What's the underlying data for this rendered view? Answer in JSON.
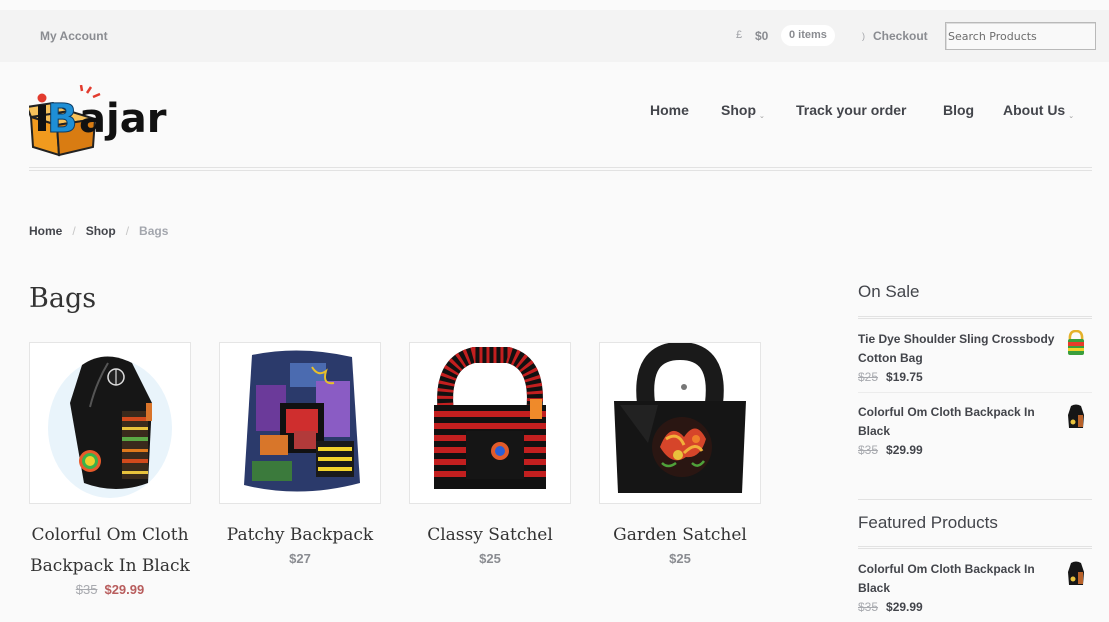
{
  "topbar": {
    "account": "My Account",
    "cart_icon": "£",
    "cart_amount": "$0",
    "cart_count": "0 items",
    "checkout_icon": ")",
    "checkout": "Checkout",
    "search_placeholder": "Search Products"
  },
  "logo": {
    "icon": "ibajar-box-logo"
  },
  "nav": {
    "items": [
      {
        "label": "Home"
      },
      {
        "label": "Shop",
        "has_submenu": true
      },
      {
        "label": "Track your order"
      },
      {
        "label": "Blog"
      },
      {
        "label": "About Us",
        "has_submenu": true
      }
    ],
    "caret": "⌄"
  },
  "breadcrumb": {
    "items": [
      "Home",
      "Shop"
    ],
    "current": "Bags",
    "separator": "/"
  },
  "page_title": "Bags",
  "products": [
    {
      "name": "Colorful Om Cloth Backpack In Black",
      "price_old": "$35",
      "price": "$29.99",
      "image_icon": "black-peace-backpack-icon"
    },
    {
      "name": "Patchy Backpack",
      "price": "$27",
      "image_icon": "patchwork-backpack-icon"
    },
    {
      "name": "Classy Satchel",
      "price": "$25",
      "image_icon": "red-black-striped-satchel-icon"
    },
    {
      "name": "Garden Satchel",
      "price": "$25",
      "image_icon": "embroidered-black-satchel-icon"
    }
  ],
  "sidebar": {
    "on_sale": {
      "title": "On Sale",
      "items": [
        {
          "name": "Tie Dye Shoulder Sling Crossbody Cotton Bag",
          "price_old": "$25",
          "price": "$19.75",
          "thumb_icon": "tie-dye-bag-icon"
        },
        {
          "name": "Colorful Om Cloth Backpack In Black",
          "price_old": "$35",
          "price": "$29.99",
          "thumb_icon": "black-backpack-icon"
        }
      ]
    },
    "featured": {
      "title": "Featured Products",
      "items": [
        {
          "name": "Colorful Om Cloth Backpack In Black",
          "price_old": "$35",
          "price": "$29.99",
          "thumb_icon": "black-backpack-icon"
        }
      ]
    }
  },
  "colors": {
    "sale_price": "#b85d5d",
    "text": "#43454b",
    "muted": "#8a8c91",
    "logo_blue": "#1e8fd6",
    "logo_orange": "#f19a1e"
  }
}
